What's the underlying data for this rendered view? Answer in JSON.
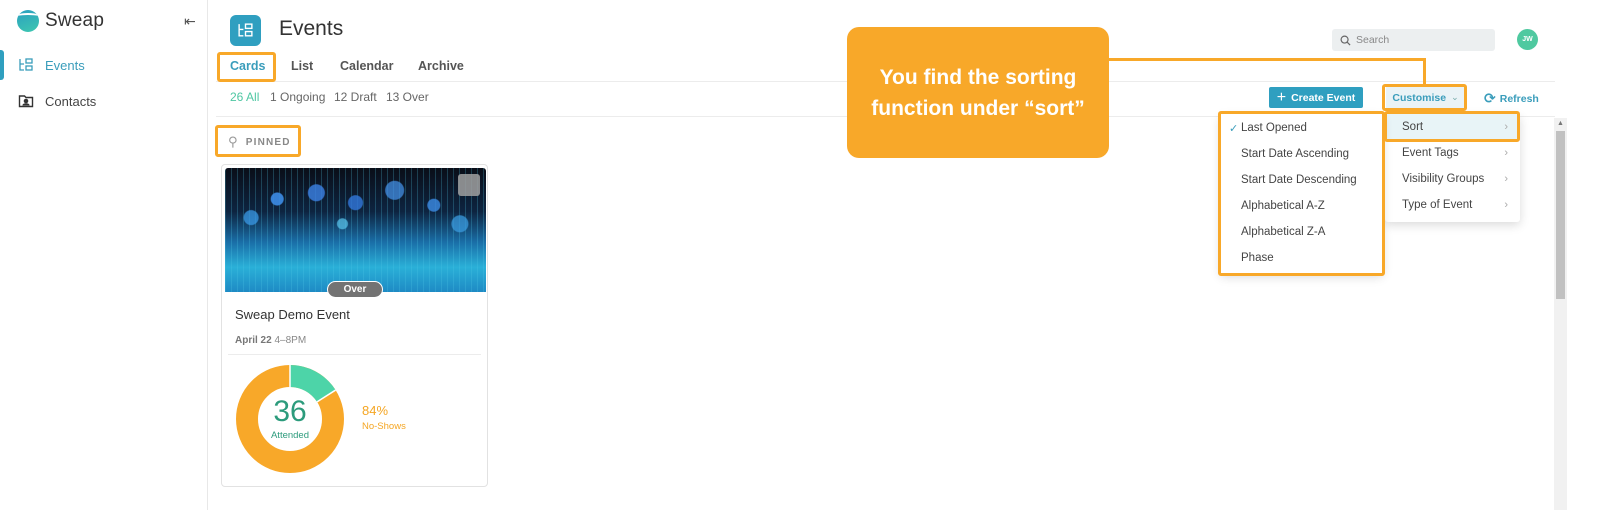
{
  "sidebar": {
    "brand": "Sweap",
    "collapse_icon": "collapse-left-icon",
    "items": [
      {
        "label": "Events",
        "icon": "events-icon",
        "active": true
      },
      {
        "label": "Contacts",
        "icon": "contacts-icon",
        "active": false
      }
    ]
  },
  "header": {
    "title": "Events",
    "search_placeholder": "Search",
    "avatar_initials": "JW"
  },
  "tabs": [
    {
      "label": "Cards",
      "active": true
    },
    {
      "label": "List",
      "active": false
    },
    {
      "label": "Calendar",
      "active": false
    },
    {
      "label": "Archive",
      "active": false
    }
  ],
  "filters": [
    {
      "label": "26 All",
      "active": true
    },
    {
      "label": "1 Ongoing",
      "active": false
    },
    {
      "label": "12 Draft",
      "active": false
    },
    {
      "label": "13 Over",
      "active": false
    }
  ],
  "toolbar": {
    "create_label": "Create Event",
    "customise_label": "Customise",
    "refresh_label": "Refresh"
  },
  "pinned_label": "PINNED",
  "card": {
    "status": "Over",
    "title": "Sweap Demo Event",
    "date_bold": "April 22",
    "time": "4–8PM",
    "attended_count": "36",
    "attended_label": "Attended",
    "noshow_pct": "84%",
    "noshow_label": "No-Shows",
    "attended_fraction": 0.16,
    "colors": {
      "attended": "#4dd4a8",
      "noshow": "#f8a829"
    }
  },
  "customise_menu": [
    {
      "label": "Sort",
      "highlighted": true
    },
    {
      "label": "Event Tags",
      "highlighted": false
    },
    {
      "label": "Visibility Groups",
      "highlighted": false
    },
    {
      "label": "Type of Event",
      "highlighted": false
    }
  ],
  "sort_menu": [
    {
      "label": "Last Opened",
      "checked": true
    },
    {
      "label": "Start Date Ascending",
      "checked": false
    },
    {
      "label": "Start Date Descending",
      "checked": false
    },
    {
      "label": "Alphabetical A-Z",
      "checked": false
    },
    {
      "label": "Alphabetical Z-A",
      "checked": false
    },
    {
      "label": "Phase",
      "checked": false
    }
  ],
  "annotation": {
    "callout_text": "You find the sorting function under “sort”",
    "color": "#f8a829"
  }
}
